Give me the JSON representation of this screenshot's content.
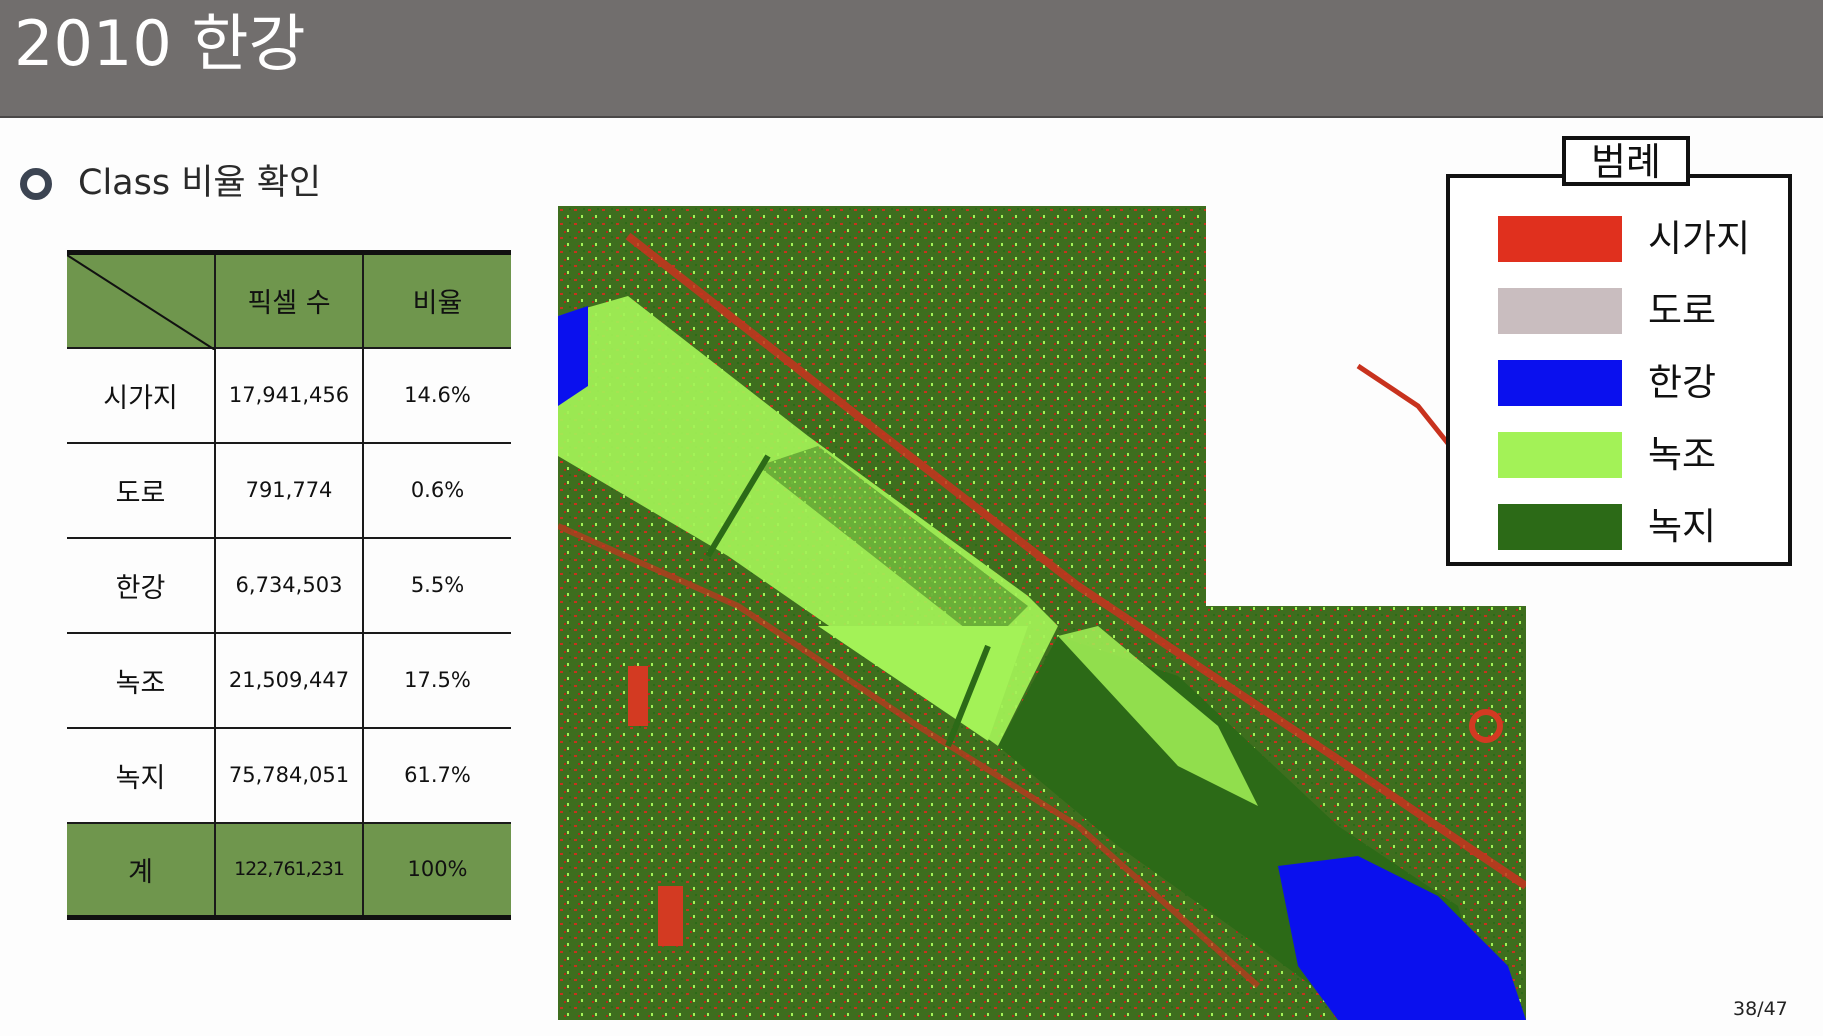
{
  "slide": {
    "title": "2010 한강",
    "subtitle": "Class 비율 확인",
    "page_number": "38/47"
  },
  "table": {
    "headers": [
      "",
      "픽셀 수",
      "비율"
    ],
    "rows": [
      {
        "label": "시가지",
        "pixels": "17,941,456",
        "ratio": "14.6%"
      },
      {
        "label": "도로",
        "pixels": "791,774",
        "ratio": "0.6%"
      },
      {
        "label": "한강",
        "pixels": "6,734,503",
        "ratio": "5.5%"
      },
      {
        "label": "녹조",
        "pixels": "21,509,447",
        "ratio": "17.5%"
      },
      {
        "label": "녹지",
        "pixels": "75,784,051",
        "ratio": "61.7%"
      }
    ],
    "total": {
      "label": "계",
      "pixels": "122,761,231",
      "ratio": "100%"
    }
  },
  "legend": {
    "title": "범례",
    "items": [
      {
        "label": "시가지",
        "color": "#e0301e"
      },
      {
        "label": "도로",
        "color": "#c9bdbf"
      },
      {
        "label": "한강",
        "color": "#0a10ee"
      },
      {
        "label": "녹조",
        "color": "#a3f257"
      },
      {
        "label": "녹지",
        "color": "#2c6a17"
      }
    ]
  },
  "colors": {
    "header_bar": "#716e6d",
    "table_header": "#6f964d"
  }
}
